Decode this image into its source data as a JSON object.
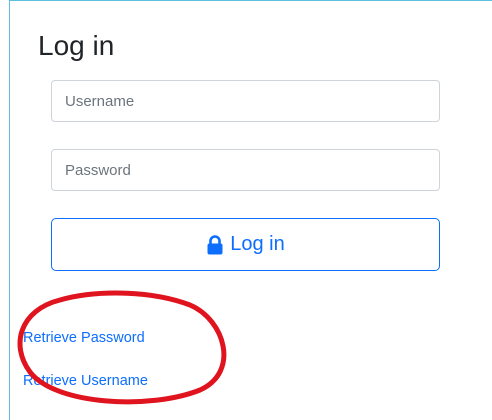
{
  "form": {
    "title": "Log in",
    "username_placeholder": "Username",
    "password_placeholder": "Password",
    "login_button_label": "Log in",
    "login_button_icon": "lock-icon"
  },
  "links": {
    "retrieve_password": "Retrieve Password",
    "retrieve_username": "Retrieve Username"
  },
  "colors": {
    "accent": "#0d6efd",
    "annotation": "#e0141e",
    "panel_border": "#5bc0de"
  }
}
